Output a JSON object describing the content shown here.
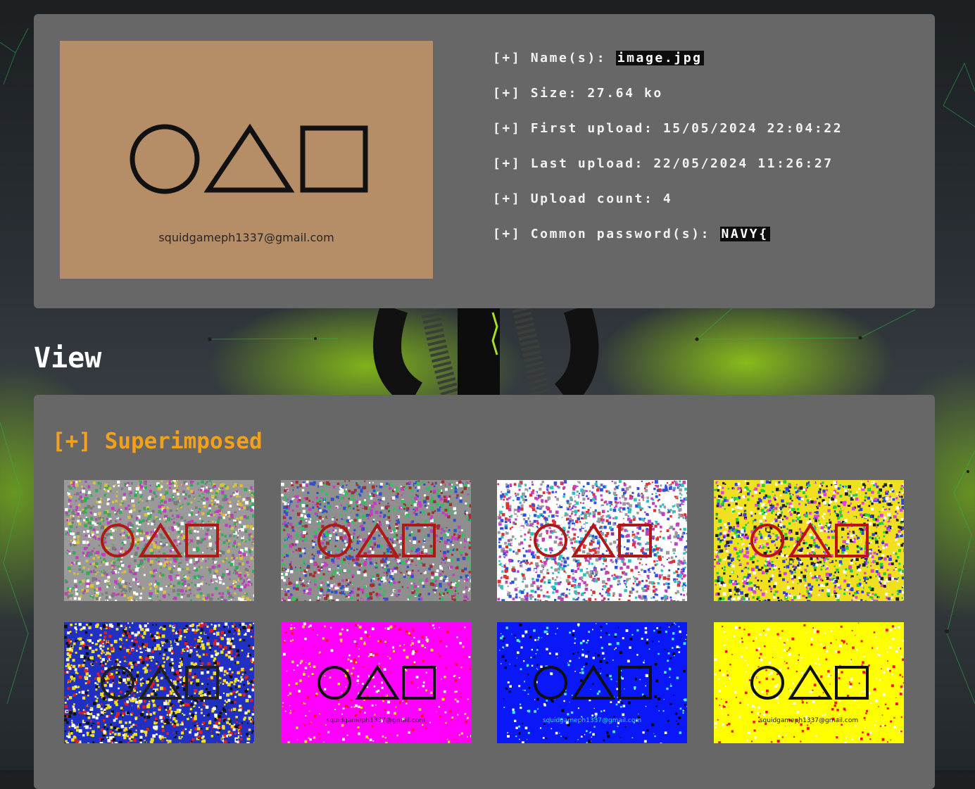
{
  "file_info": {
    "preview": {
      "email_text": "squidgameph1337@gmail.com",
      "background_color": "#b58e67"
    },
    "rows": [
      {
        "label": "[+] Name(s): ",
        "value": "image.jpg"
      },
      {
        "label": "[+] Size: 27.64 ko"
      },
      {
        "label": "[+] First upload: 15/05/2024 22:04:22"
      },
      {
        "label": "[+] Last upload: 22/05/2024 11:26:27"
      },
      {
        "label": "[+] Upload count: 4"
      },
      {
        "label": "[+] Common password(s): ",
        "value": "NAVY{"
      }
    ]
  },
  "view": {
    "heading": "View",
    "section_title": "[+] Superimposed",
    "accent_color": "#f3a01c",
    "thumbnails": [
      {
        "style": "noise",
        "colors": [
          "#9a9a9a",
          "#c03cc0",
          "#2fae57",
          "#ffffff",
          "#7a7a7a",
          "#d8c040"
        ],
        "shape_color": "#b01818",
        "show_email": false
      },
      {
        "style": "noise",
        "colors": [
          "#8f8f8f",
          "#c040c0",
          "#30c060",
          "#ffffff",
          "#a03030",
          "#3050d0"
        ],
        "shape_color": "#b01818",
        "show_email": false
      },
      {
        "style": "noise",
        "colors": [
          "#ffffff",
          "#3050e0",
          "#c040c0",
          "#9a9a9a",
          "#e03030",
          "#30c0c0"
        ],
        "shape_color": "#b01818",
        "show_email": false
      },
      {
        "style": "noise",
        "colors": [
          "#f0e020",
          "#e040e0",
          "#20d040",
          "#3040e0",
          "#ffffff",
          "#202020"
        ],
        "shape_color": "#c01010",
        "show_email": false
      },
      {
        "style": "noise",
        "colors": [
          "#2030c0",
          "#f0e020",
          "#e02020",
          "#101010",
          "#ffffff",
          "#f0e020"
        ],
        "shape_color": "#202020",
        "show_email": false
      },
      {
        "style": "speckle",
        "base": "#ff00ff",
        "colors": [
          "#ff1020",
          "#ffe020",
          "#ffffff"
        ],
        "shape_color": "#101010",
        "show_email": true,
        "email_color": "#202020"
      },
      {
        "style": "speckle",
        "base": "#0a18f8",
        "colors": [
          "#40f0f0",
          "#ffffff",
          "#000000"
        ],
        "shape_color": "#101010",
        "show_email": true,
        "email_color": "#20e0e0"
      },
      {
        "style": "speckle",
        "base": "#ffff00",
        "colors": [
          "#ff1010",
          "#ffffff"
        ],
        "shape_color": "#101010",
        "show_email": true,
        "email_color": "#101010"
      }
    ]
  }
}
